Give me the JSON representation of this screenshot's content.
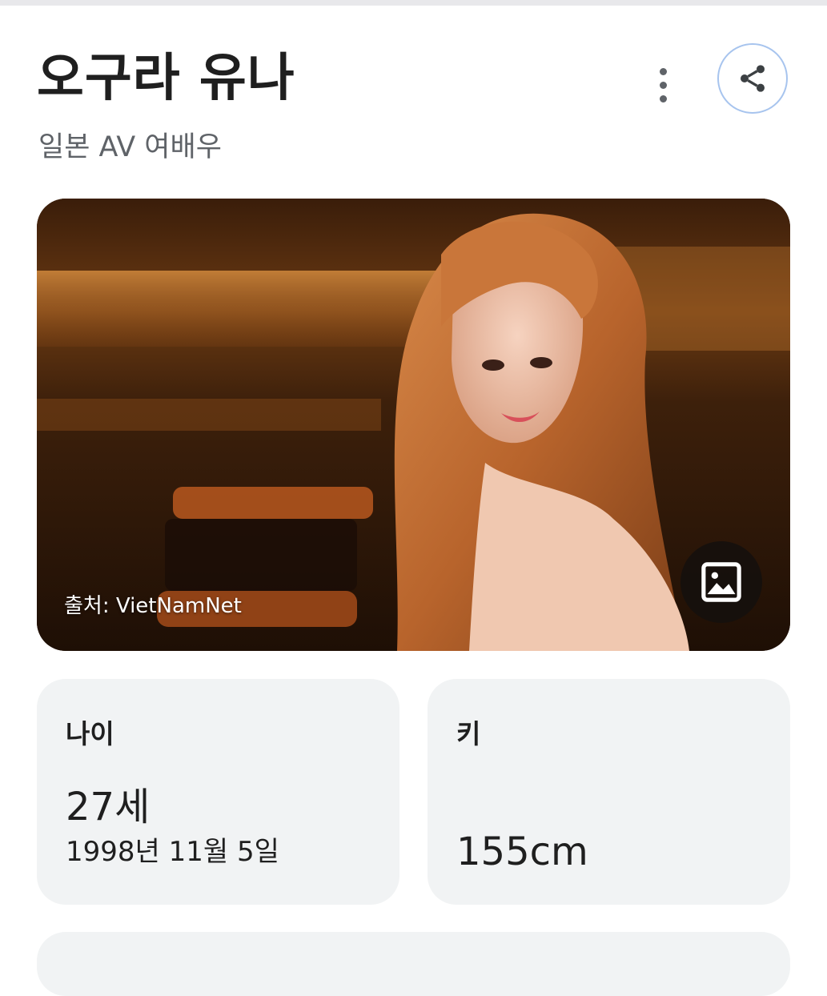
{
  "header": {
    "title": "오구라 유나",
    "subtitle": "일본 AV 여배우",
    "more_icon": "more-vertical-icon",
    "share_icon": "share-icon"
  },
  "photo": {
    "source_label": "출처: VietNamNet",
    "gallery_icon": "image-icon"
  },
  "facts": {
    "age": {
      "label": "나이",
      "value": "27세",
      "detail": "1998년 11월 5일"
    },
    "height": {
      "label": "키",
      "value": "155cm"
    }
  },
  "colors": {
    "card_bg": "#f1f3f4",
    "share_border": "#a7c4ee",
    "text_secondary": "#5f6368"
  }
}
